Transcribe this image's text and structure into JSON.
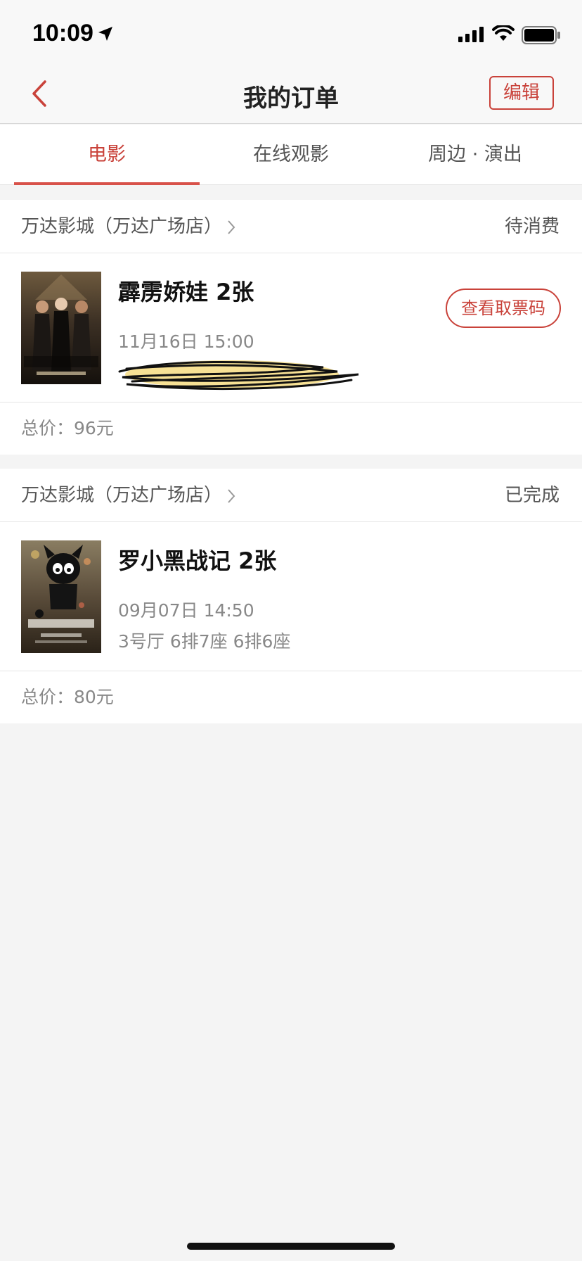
{
  "status_bar": {
    "time": "10:09"
  },
  "nav": {
    "title": "我的订单",
    "edit_label": "编辑"
  },
  "tabs": [
    {
      "label": "电影",
      "active": true
    },
    {
      "label": "在线观影",
      "active": false
    },
    {
      "label": "周边 · 演出",
      "active": false
    }
  ],
  "orders": [
    {
      "cinema": "万达影城（万达广场店）",
      "status": "待消费",
      "movie": "霹雳娇娃 2张",
      "showtime": "11月16日 15:00",
      "ticket_button": "查看取票码",
      "total": "总价：96元"
    },
    {
      "cinema": "万达影城（万达广场店）",
      "status": "已完成",
      "movie": "罗小黑战记 2张",
      "showtime": "09月07日 14:50",
      "seats": "3号厅 6排7座 6排6座",
      "total": "总价：80元"
    }
  ],
  "colors": {
    "accent": "#c9423a",
    "background": "#f4f4f4"
  }
}
